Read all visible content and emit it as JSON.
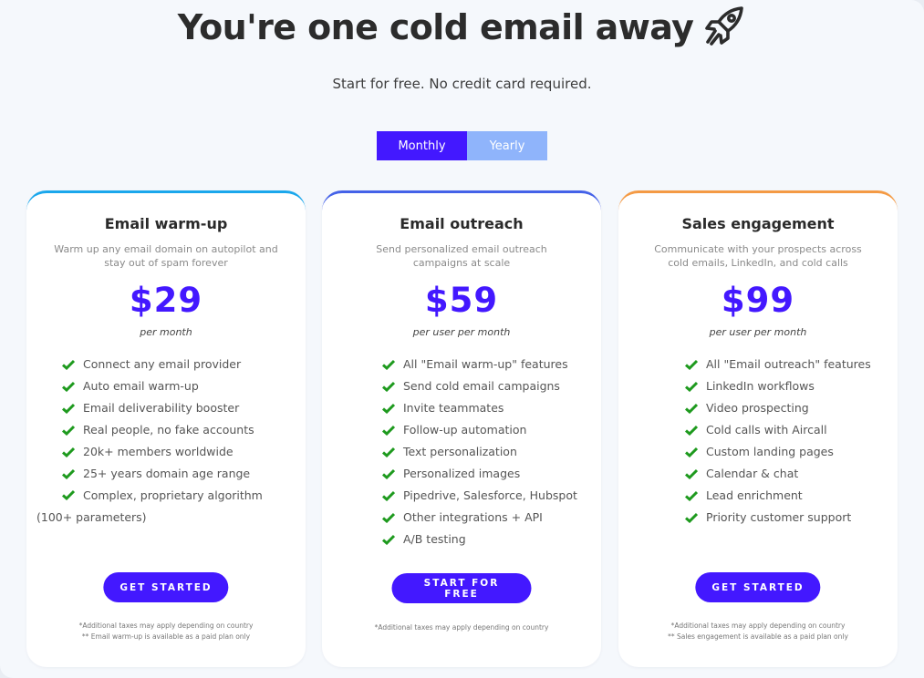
{
  "hero": {
    "title": "You're one cold email away",
    "title_icon": "rocket-icon",
    "subtitle": "Start for free. No credit card required."
  },
  "billing_toggle": {
    "options": [
      "Monthly",
      "Yearly"
    ],
    "selected": "Monthly"
  },
  "colors": {
    "accent": "#4318ff",
    "toggle_inactive": "#8fb4fb",
    "check": "#1e9a1e",
    "card_warmup_top": "#1aa7ec",
    "card_outreach_top": "#4462e8",
    "card_sales_top": "#f49a44"
  },
  "plans": [
    {
      "name": "Email warm-up",
      "description": "Warm up any email domain on autopilot and stay out of spam forever",
      "price": "$29",
      "period": "per month",
      "features": [
        "Connect any email provider",
        "Auto email warm-up",
        "Email deliverability booster",
        "Real people, no fake accounts",
        "20k+ members worldwide",
        "25+ years domain age range",
        "Complex, proprietary algorithm (100+ parameters)"
      ],
      "cta": "GET STARTED",
      "notes": [
        "*Additional taxes may apply depending on country",
        "** Email warm-up is available as a paid plan only"
      ]
    },
    {
      "name": "Email outreach",
      "description": "Send personalized email outreach campaigns at scale",
      "price": "$59",
      "period": "per user per month",
      "features": [
        "All \"Email warm-up\" features",
        "Send cold email campaigns",
        "Invite teammates",
        "Follow-up automation",
        "Text personalization",
        "Personalized images",
        "Pipedrive, Salesforce, Hubspot",
        "Other integrations + API",
        "A/B testing"
      ],
      "cta": "START FOR FREE",
      "notes": [
        "*Additional taxes may apply depending on country"
      ]
    },
    {
      "name": "Sales engagement",
      "description": "Communicate with your prospects across cold emails, LinkedIn, and cold calls",
      "price": "$99",
      "period": "per user per month",
      "features": [
        "All \"Email outreach\" features",
        "LinkedIn workflows",
        "Video prospecting",
        "Cold calls with Aircall",
        "Custom landing pages",
        "Calendar & chat",
        "Lead enrichment",
        "Priority customer support"
      ],
      "cta": "GET STARTED",
      "notes": [
        "*Additional taxes may apply depending on country",
        "** Sales engagement is available as a paid plan only"
      ]
    }
  ]
}
